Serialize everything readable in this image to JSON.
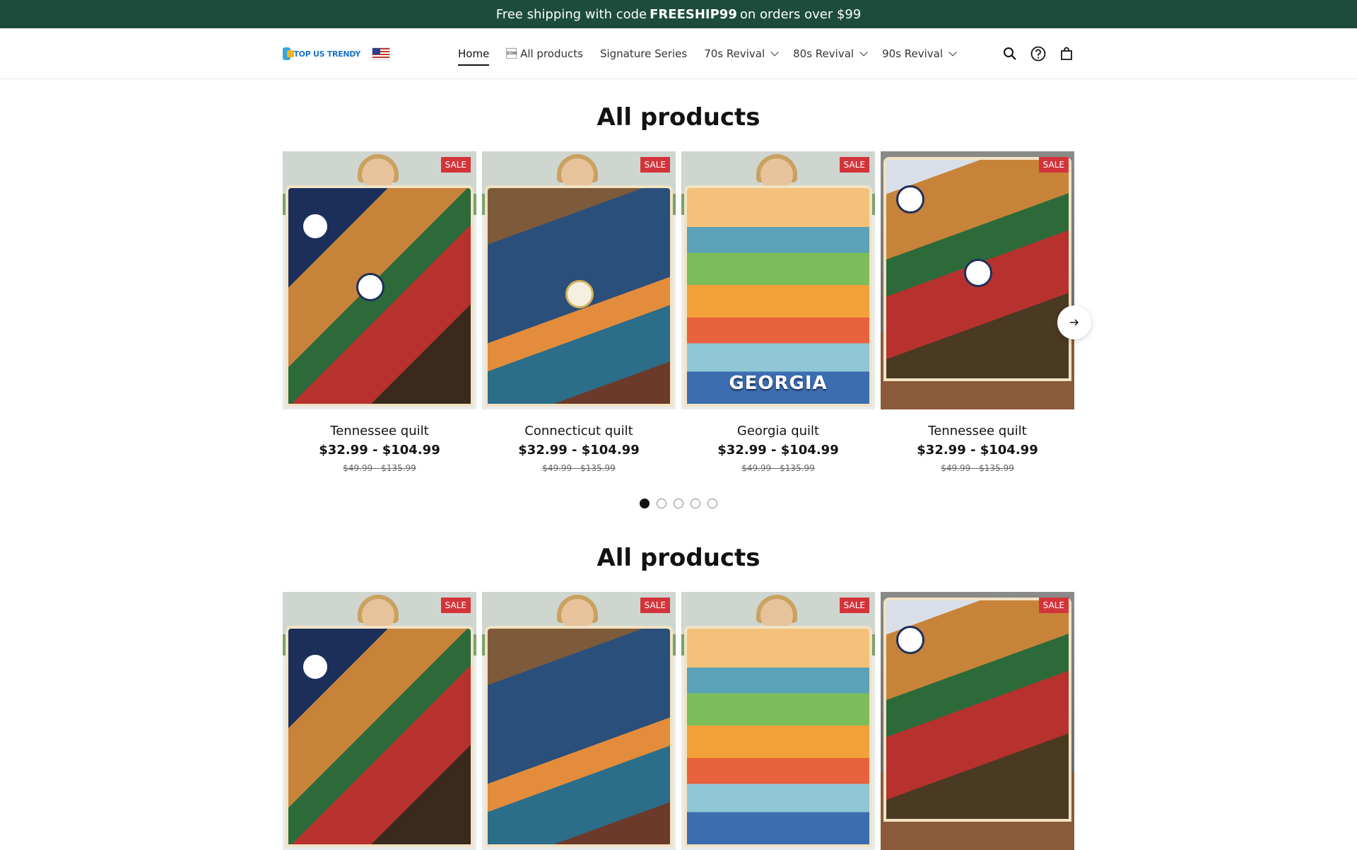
{
  "announcement": {
    "prefix": "Free shipping with code",
    "code": "FREESHIP99",
    "suffix": "on orders over $99"
  },
  "header": {
    "logo_text": "TOP US TRENDY",
    "nav": [
      {
        "label": "Home",
        "active": true
      },
      {
        "label": "\u0001 All products"
      },
      {
        "label": "Signature Series"
      },
      {
        "label": "70s Revival",
        "dropdown": true
      },
      {
        "label": "80s Revival",
        "dropdown": true
      },
      {
        "label": "90s Revival",
        "dropdown": true
      }
    ],
    "icons": [
      "search-icon",
      "help-icon",
      "cart-icon"
    ]
  },
  "sections": [
    {
      "title": "All products",
      "products": [
        {
          "name": "Tennessee quilt",
          "price": "$32.99 - $104.99",
          "old_price": "$49.99 - $135.99",
          "badge": "SALE"
        },
        {
          "name": "Connecticut quilt",
          "price": "$32.99 - $104.99",
          "old_price": "$49.99 - $135.99",
          "badge": "SALE"
        },
        {
          "name": "Georgia quilt",
          "price": "$32.99 - $104.99",
          "old_price": "$49.99 - $135.99",
          "badge": "SALE"
        },
        {
          "name": "Tennessee quilt",
          "price": "$32.99 - $104.99",
          "old_price": "$49.99 - $135.99",
          "badge": "SALE"
        }
      ],
      "pagination": {
        "pages": 5,
        "current": 1
      }
    },
    {
      "title": "All products",
      "products": [
        {
          "badge": "SALE"
        },
        {
          "badge": "SALE"
        },
        {
          "badge": "SALE"
        },
        {
          "badge": "SALE"
        }
      ]
    }
  ],
  "quilt_texts": {
    "georgia": "GEORGIA"
  },
  "colors": {
    "announcement_bg": "#1d4c3c",
    "sale_badge": "#d3343a"
  }
}
